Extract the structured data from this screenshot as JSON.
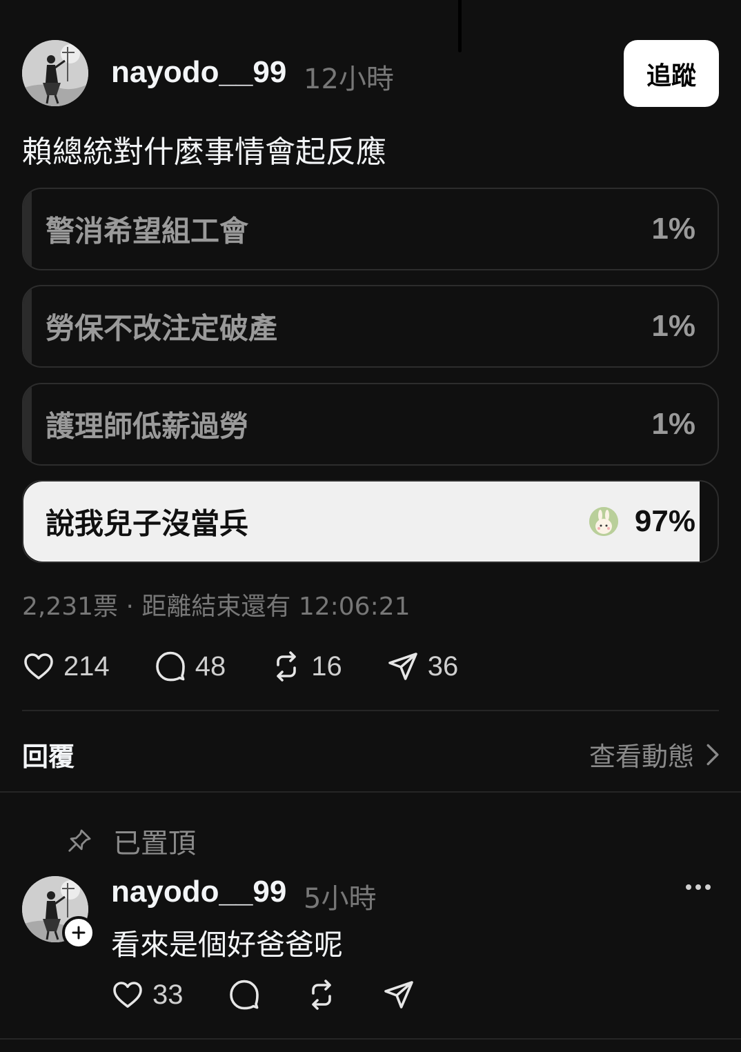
{
  "post": {
    "username": "nayodo__99",
    "time": "12小時",
    "follow_label": "追蹤",
    "text": "賴總統對什麼事情會起反應",
    "avatar_icon": "user-avatar-photo"
  },
  "poll": {
    "options": [
      {
        "label": "警消希望組工會",
        "percent": "1%",
        "fraction": 0.01
      },
      {
        "label": "勞保不改注定破產",
        "percent": "1%",
        "fraction": 0.01
      },
      {
        "label": "護理師低薪過勞",
        "percent": "1%",
        "fraction": 0.01
      },
      {
        "label": "說我兒子沒當兵",
        "percent": "97%",
        "fraction": 0.97,
        "selected": true
      }
    ],
    "meta": "2,231票 · 距離結束還有 12:06:21"
  },
  "actions": {
    "likes": "214",
    "comments": "48",
    "reposts": "16",
    "shares": "36"
  },
  "replies_section": {
    "title": "回覆",
    "view_activity": "查看動態"
  },
  "reply": {
    "pinned_label": "已置頂",
    "username": "nayodo__99",
    "time": "5小時",
    "text": "看來是個好爸爸呢",
    "likes": "33"
  },
  "colors": {
    "background": "#101010",
    "winner_fill": "#f0f0f0",
    "muted_text": "#777777"
  }
}
